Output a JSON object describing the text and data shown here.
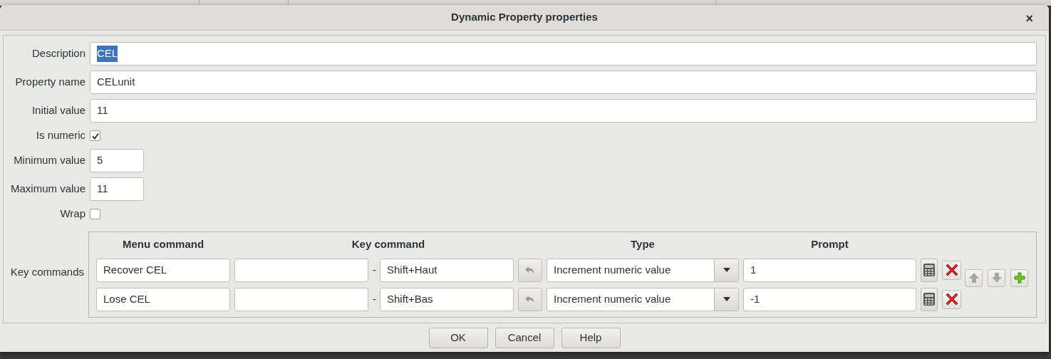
{
  "window": {
    "title": "Dynamic Property properties",
    "close": "×"
  },
  "fields": [
    {
      "kind": "text",
      "label": "Description",
      "value": "CEL",
      "highlighted": true
    },
    {
      "kind": "text",
      "label": "Property name",
      "value": "CELunit"
    },
    {
      "kind": "text",
      "label": "Initial value",
      "value": "11"
    },
    {
      "kind": "checkbox",
      "label": "Is numeric",
      "checked": true
    },
    {
      "kind": "short_text",
      "label": "Minimum value",
      "value": "5"
    },
    {
      "kind": "short_text",
      "label": "Maximum value",
      "value": "11"
    },
    {
      "kind": "checkbox",
      "label": "Wrap",
      "checked": false
    }
  ],
  "key_commands": {
    "label": "Key commands",
    "columns": [
      "Menu command",
      "Key command",
      "Type",
      "Prompt"
    ],
    "rows": [
      {
        "menu_command": "Recover CEL",
        "separator": "-",
        "key": "Shift+Haut",
        "type": "Increment numeric value",
        "prompt": "1"
      },
      {
        "menu_command": "Lose CEL",
        "separator": "-",
        "key": "Shift+Bas",
        "type": "Increment numeric value",
        "prompt": "-1"
      }
    ],
    "side_buttons": [
      {
        "kind": "up",
        "disabled": true
      },
      {
        "kind": "down",
        "disabled": true
      },
      {
        "kind": "add",
        "disabled": false
      }
    ]
  },
  "buttons": [
    "OK",
    "Cancel",
    "Help"
  ]
}
